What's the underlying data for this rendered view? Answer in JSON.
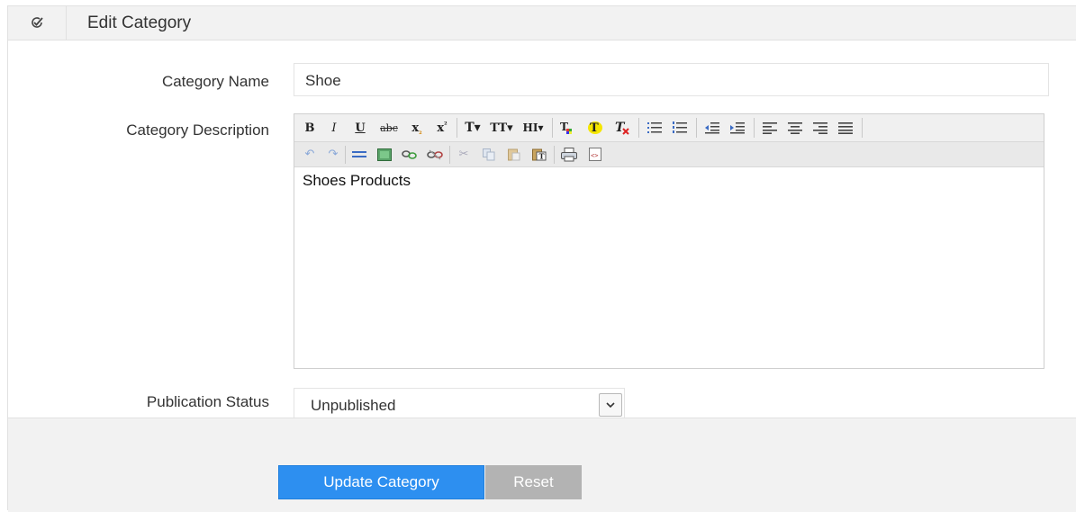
{
  "header": {
    "title": "Edit Category",
    "icon": "edit-check-icon"
  },
  "form": {
    "category_name_label": "Category Name",
    "category_name_value": "Shoe",
    "category_description_label": "Category Description",
    "category_description_value": "Shoes Products",
    "publication_status_label": "Publication Status",
    "publication_status_value": "Unpublished"
  },
  "toolbar": {
    "row1": [
      {
        "name": "bold-button",
        "glyph": "B"
      },
      {
        "name": "italic-button",
        "glyph": "I"
      },
      {
        "name": "underline-button",
        "glyph": "U"
      },
      {
        "name": "strikethrough-button",
        "glyph": "abc"
      },
      {
        "name": "subscript-button",
        "glyph": "x₂"
      },
      {
        "name": "superscript-button",
        "glyph": "x²"
      },
      {
        "name": "font-button",
        "glyph": "T▾"
      },
      {
        "name": "font-size-button",
        "glyph": "TT▾"
      },
      {
        "name": "heading-button",
        "glyph": "HI▾"
      },
      {
        "name": "text-color-button",
        "glyph": "T"
      },
      {
        "name": "highlight-color-button",
        "glyph": "T"
      },
      {
        "name": "clear-format-button",
        "glyph": "T"
      },
      {
        "name": "bullet-list-button",
        "glyph": "☰"
      },
      {
        "name": "numbered-list-button",
        "glyph": "☰"
      },
      {
        "name": "outdent-button",
        "glyph": "⇤"
      },
      {
        "name": "indent-button",
        "glyph": "⇥"
      },
      {
        "name": "align-left-button",
        "glyph": "≡"
      },
      {
        "name": "align-center-button",
        "glyph": "≡"
      },
      {
        "name": "align-right-button",
        "glyph": "≡"
      },
      {
        "name": "justify-button",
        "glyph": "≡"
      }
    ],
    "row2": [
      {
        "name": "undo-button",
        "glyph": "↶"
      },
      {
        "name": "redo-button",
        "glyph": "↷"
      },
      {
        "name": "horizontal-rule-button",
        "glyph": "▬"
      },
      {
        "name": "insert-image-button",
        "glyph": "■"
      },
      {
        "name": "insert-link-button",
        "glyph": "⚭"
      },
      {
        "name": "unlink-button",
        "glyph": "⚮"
      },
      {
        "name": "cut-button",
        "glyph": "✂"
      },
      {
        "name": "copy-button",
        "glyph": "❐"
      },
      {
        "name": "paste-button",
        "glyph": "📋"
      },
      {
        "name": "paste-text-button",
        "glyph": "T"
      },
      {
        "name": "print-button",
        "glyph": "⎙"
      },
      {
        "name": "source-code-button",
        "glyph": "<>"
      }
    ]
  },
  "buttons": {
    "update_label": "Update Category",
    "reset_label": "Reset"
  },
  "colors": {
    "primary": "#2d8ff0",
    "reset": "#b3b3b3",
    "header_bg": "#f2f2f2"
  }
}
